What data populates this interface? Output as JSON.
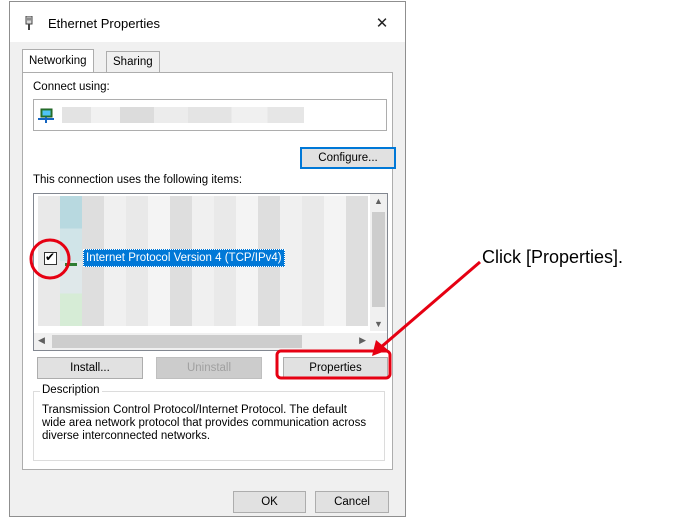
{
  "dialog": {
    "title": "Ethernet Properties",
    "close_glyph": "✕",
    "tabs": [
      {
        "label": "Networking",
        "active": true
      },
      {
        "label": "Sharing",
        "active": false
      }
    ]
  },
  "networking": {
    "connect_using_label": "Connect using:",
    "configure_label": "Configure...",
    "items_label": "This connection uses the following items:",
    "selected_item": {
      "label": "Internet Protocol Version 4 (TCP/IPv4)",
      "checked": true,
      "check_glyph": "✔"
    },
    "buttons": {
      "install": "Install...",
      "uninstall": "Uninstall",
      "properties": "Properties"
    },
    "description": {
      "legend": "Description",
      "text": "Transmission Control Protocol/Internet Protocol. The default wide area network protocol that provides communication across diverse interconnected networks."
    }
  },
  "footer": {
    "ok": "OK",
    "cancel": "Cancel"
  },
  "annotation": {
    "label": "Click [Properties].",
    "color": "#e60012"
  },
  "icons": {
    "title": "ethernet-plug-icon",
    "adapter": "network-adapter-icon",
    "protocol": "protocol-icon"
  },
  "colors": {
    "selection": "#0078d7",
    "default_button_border": "#0078d7",
    "highlight": "#e60012"
  }
}
